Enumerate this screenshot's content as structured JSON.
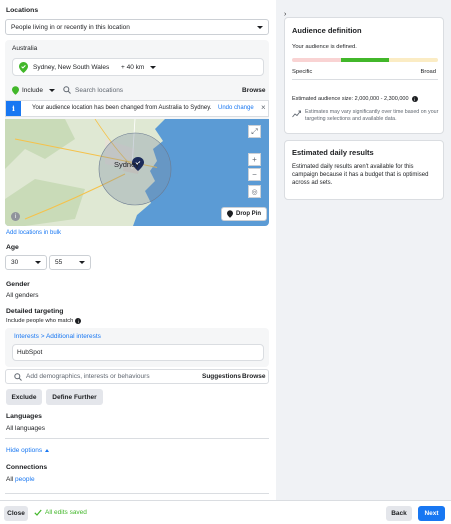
{
  "locations": {
    "heading": "Locations",
    "type_select": "People living in or recently in this location",
    "country": "Australia",
    "place": "Sydney, New South Wales",
    "radius": "+ 40 km",
    "include_label": "Include",
    "search_placeholder": "Search locations",
    "browse": "Browse",
    "notice_text": "Your audience location has been changed from Australia to Sydney.",
    "undo": "Undo change",
    "map_city": "Sydney",
    "drop_pin": "Drop Pin",
    "add_bulk": "Add locations in bulk"
  },
  "age": {
    "heading": "Age",
    "min": "30",
    "max": "55"
  },
  "gender": {
    "heading": "Gender",
    "value": "All genders"
  },
  "detailed": {
    "heading": "Detailed targeting",
    "sub": "Include people who match",
    "breadcrumb": "Interests > Additional interests",
    "chip": "HubSpot",
    "search_placeholder": "Add demographics, interests or behaviours",
    "suggestions": "Suggestions",
    "browse": "Browse",
    "exclude": "Exclude",
    "define": "Define Further"
  },
  "languages": {
    "heading": "Languages",
    "value": "All languages"
  },
  "hide_options": "Hide options",
  "connections": {
    "heading": "Connections",
    "value_prefix": "All",
    "value_link": "people"
  },
  "audience_def": {
    "title": "Audience definition",
    "defined": "Your audience is defined.",
    "specific": "Specific",
    "broad": "Broad",
    "size": "Estimated audience size: 2,000,000 - 2,300,000",
    "note": "Estimates may vary significantly over time based on your targeting selections and available data."
  },
  "daily": {
    "title": "Estimated daily results",
    "text": "Estimated daily results aren't available for this campaign because it has a budget that is optimised across ad sets."
  },
  "footer": {
    "close": "Close",
    "saved": "All edits saved",
    "back": "Back",
    "next": "Next"
  },
  "colors": {
    "accent": "#1877f2",
    "success": "#42b72a"
  }
}
